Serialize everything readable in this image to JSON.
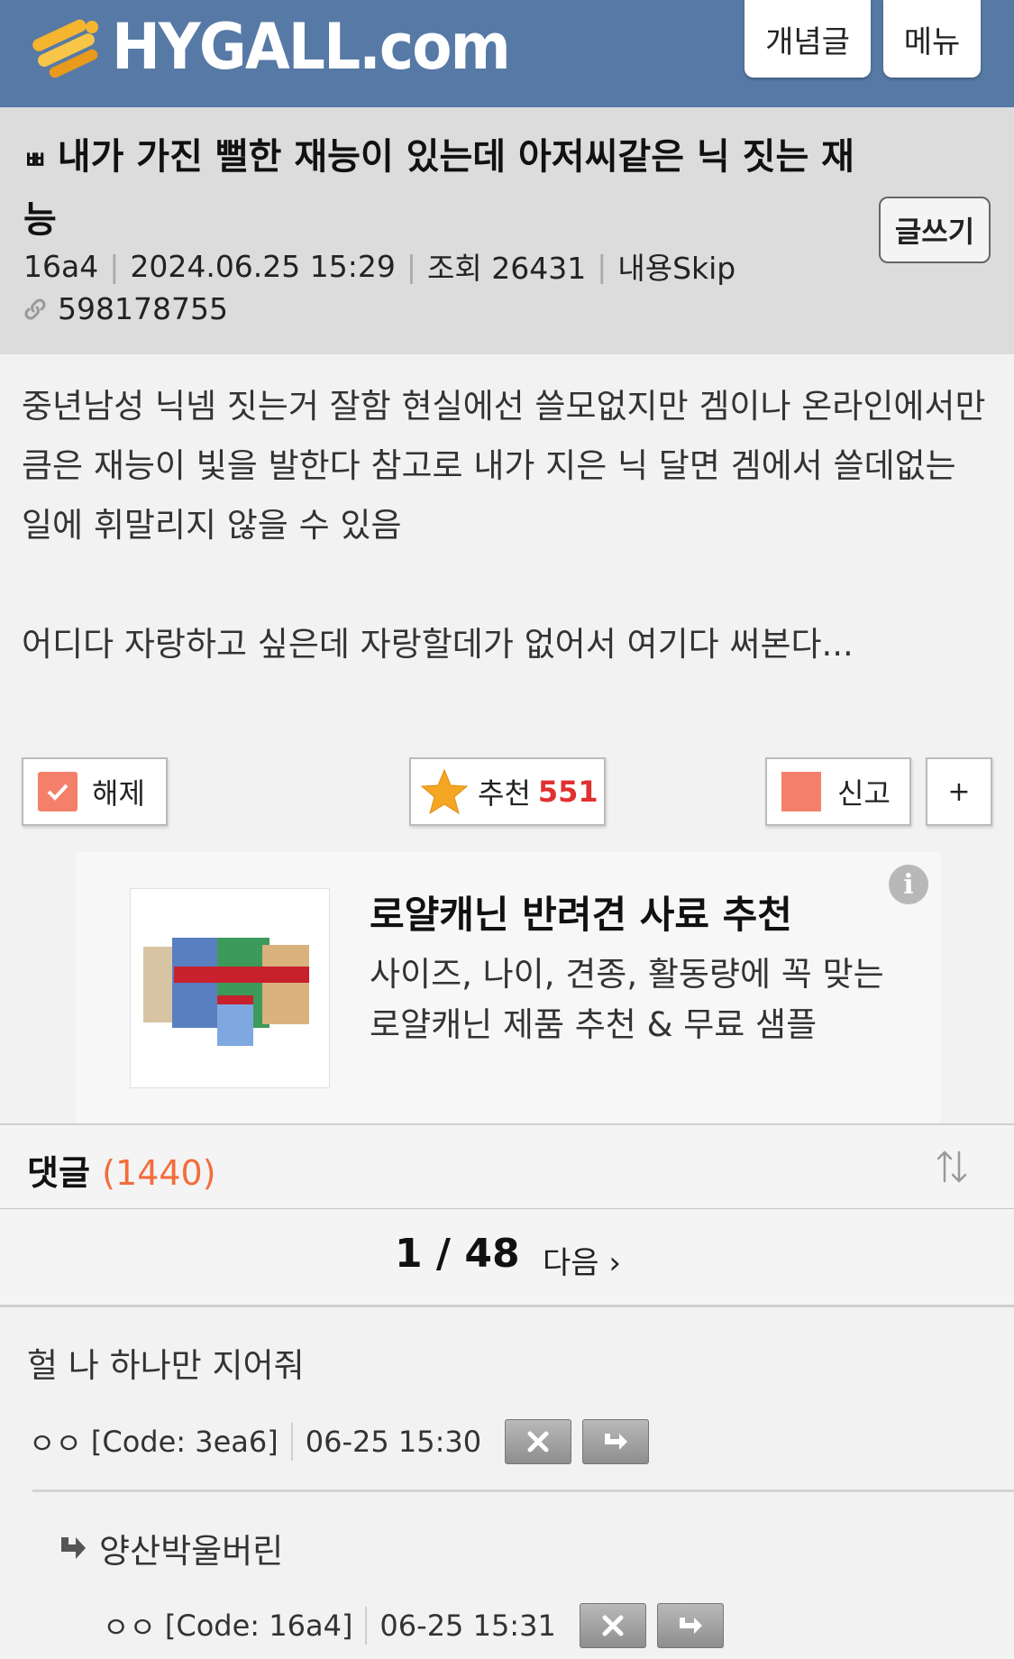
{
  "header": {
    "logo_text": "HYGALL.com",
    "concept_label": "개념글",
    "menu_label": "메뉴",
    "bg_color": "#5779a6"
  },
  "post": {
    "badge": "ㅃ",
    "title": "내가 가진 뻘한 재능이 있는데 아저씨같은 닉 짓는 재능",
    "write_label": "글쓰기",
    "author": "16a4",
    "date": "2024.06.25 15:29",
    "views_label": "조회 26431",
    "skip_label": "내용Skip",
    "post_id": "598178755",
    "body_para1": "중년남성 닉넴 짓는거 잘함 현실에선 쓸모없지만 겜이나 온라인에서만큼은 재능이 빛을 발한다 참고로 내가 지은 닉 달면 겜에서 쓸데없는 일에 휘말리지 않을 수 있음",
    "body_para2": "어디다 자랑하고 싶은데 자랑할데가 없어서 여기다 써본다..."
  },
  "actions": {
    "release_label": "해제",
    "recommend_label": "추천",
    "recommend_count": "551",
    "report_label": "신고",
    "plus_label": "+"
  },
  "ad": {
    "title": "로얄캐닌 반려견 사료 추천",
    "desc": "사이즈, 나이, 견종, 활동량에 꼭 맞는 로얄캐닌 제품 추천 & 무료 샘플",
    "info": "i"
  },
  "comments": {
    "label": "댓글",
    "count": "(1440)",
    "page": "1 / 48",
    "next_label": "다음 ›",
    "items": [
      {
        "text": "헐 나 하나만 지어줘",
        "name": "ㅇㅇ",
        "code": "[Code: 3ea6]",
        "time": "06-25 15:30"
      },
      {
        "text": "양산박울버린",
        "name": "ㅇㅇ",
        "code": "[Code: 16a4]",
        "time": "06-25 15:31"
      }
    ]
  }
}
